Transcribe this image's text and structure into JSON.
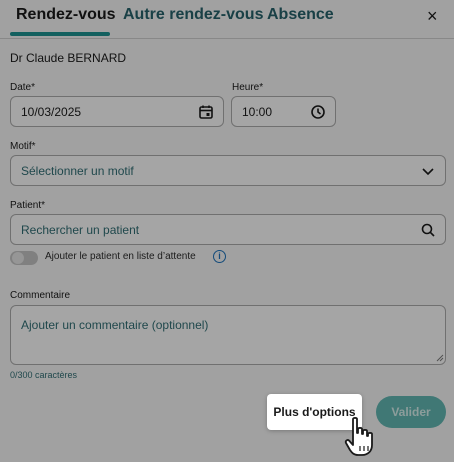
{
  "tabs": [
    {
      "label": "Rendez-vous",
      "active": true
    },
    {
      "label": "Autre rendez-vous",
      "active": false
    },
    {
      "label": "Absence",
      "active": false
    }
  ],
  "close_label": "×",
  "doctor_name": "Dr Claude BERNARD",
  "form": {
    "date_label": "Date*",
    "date_value": "10/03/2025",
    "time_label": "Heure*",
    "time_value": "10:00",
    "motif_label": "Motif*",
    "motif_placeholder": "Sélectionner un motif",
    "patient_label": "Patient*",
    "patient_placeholder": "Rechercher un patient",
    "waitlist_label": "Ajouter le patient en liste d’attente",
    "waitlist_checked": false,
    "comment_label": "Commentaire",
    "comment_placeholder": "Ajouter un commentaire (optionnel)",
    "char_count": "0/300 caractères"
  },
  "actions": {
    "more_options_label": "Plus d'options",
    "submit_label": "Valider"
  },
  "colors": {
    "accent": "#1d8e8c",
    "tab_inactive": "#255f67",
    "info": "#1d6fb5"
  }
}
